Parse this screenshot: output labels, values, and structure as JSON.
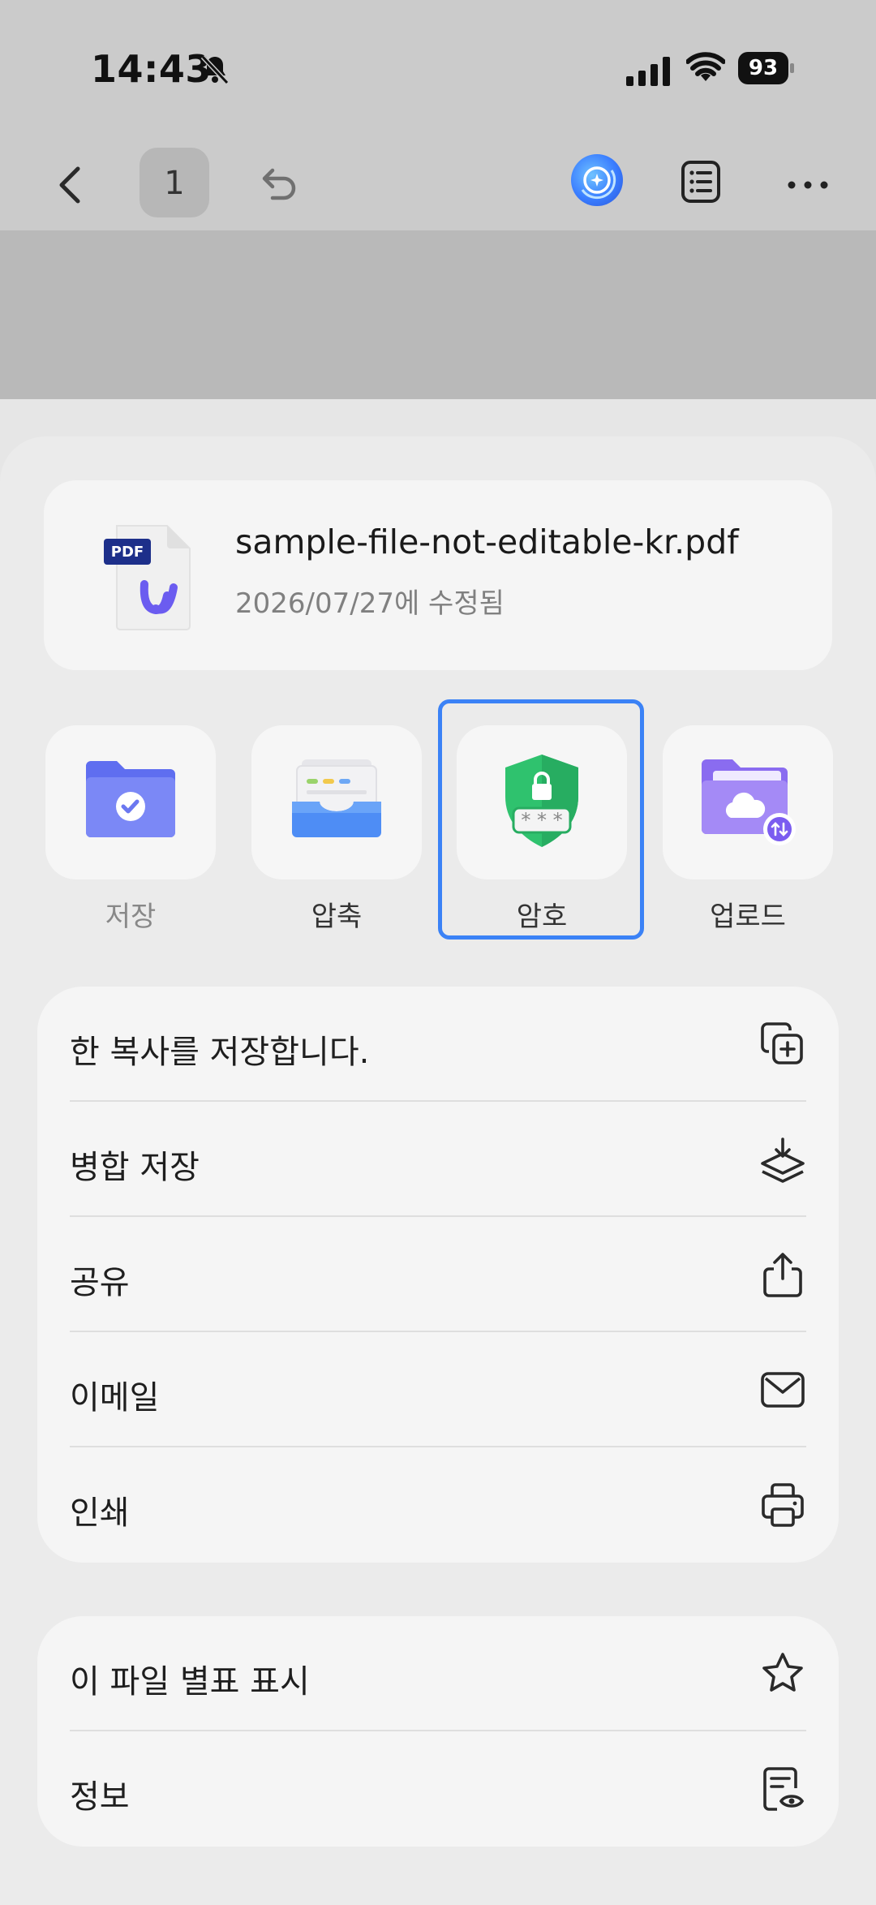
{
  "status_bar": {
    "time": "14:43",
    "battery": "93",
    "icons": [
      "bell-slash-icon",
      "signal-icon",
      "wifi-icon",
      "battery-icon"
    ]
  },
  "toolbar": {
    "page_number": "1",
    "icons": [
      "chevron-left-icon",
      "undo-icon",
      "ai-assistant-icon",
      "list-icon",
      "more-icon"
    ]
  },
  "file": {
    "name": "sample-file-not-editable-kr.pdf",
    "modified": "2026/07/27에 수정됨",
    "badge": "PDF"
  },
  "actions": [
    {
      "label": "저장",
      "icon": "folder-check-icon"
    },
    {
      "label": "압축",
      "icon": "archive-tray-icon"
    },
    {
      "label": "암호",
      "icon": "shield-lock-icon",
      "selected": true
    },
    {
      "label": "업로드",
      "icon": "cloud-folder-icon"
    }
  ],
  "menu_primary": [
    {
      "label": "한 복사를 저장합니다.",
      "icon": "copy-plus-icon"
    },
    {
      "label": "병합 저장",
      "icon": "layers-download-icon"
    },
    {
      "label": "공유",
      "icon": "share-icon"
    },
    {
      "label": "이메일",
      "icon": "mail-icon"
    },
    {
      "label": "인쇄",
      "icon": "printer-icon"
    }
  ],
  "menu_secondary": [
    {
      "label": "이 파일 별표 표시",
      "icon": "star-icon"
    },
    {
      "label": "정보",
      "icon": "document-eye-icon"
    }
  ],
  "colors": {
    "selection": "#3b82f6",
    "shield": "#2fc26e",
    "folder": "#6b78f0"
  }
}
